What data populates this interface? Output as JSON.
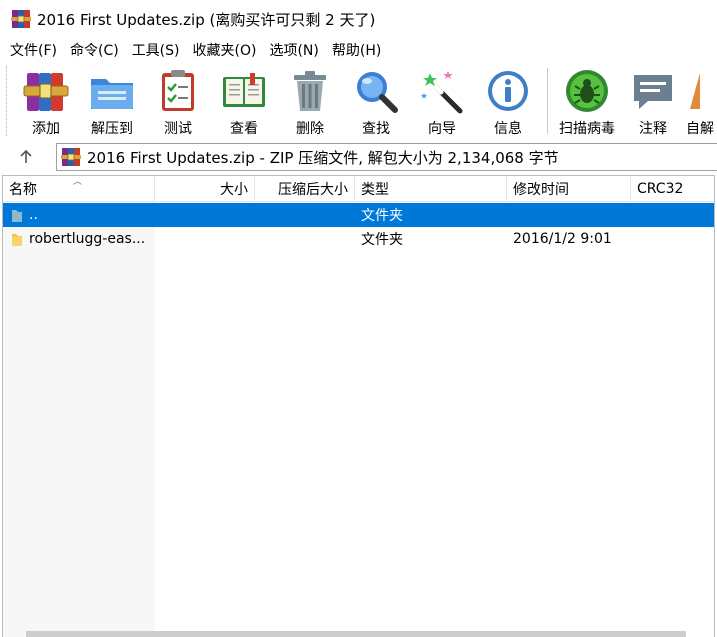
{
  "window": {
    "title": "2016 First Updates.zip (离购买许可只剩 2 天了)"
  },
  "menu": {
    "items": [
      "文件(F)",
      "命令(C)",
      "工具(S)",
      "收藏夹(O)",
      "选项(N)",
      "帮助(H)"
    ]
  },
  "toolbar": {
    "add": "添加",
    "extract": "解压到",
    "test": "测试",
    "view": "查看",
    "delete": "删除",
    "find": "查找",
    "wizard": "向导",
    "info": "信息",
    "virus_scan": "扫描病毒",
    "comment": "注释",
    "self_extract": "自解"
  },
  "address": {
    "text": "2016 First Updates.zip - ZIP 压缩文件, 解包大小为 2,134,068 字节"
  },
  "columns": {
    "name": "名称",
    "size": "大小",
    "packed": "压缩后大小",
    "type": "类型",
    "modified": "修改时间",
    "crc": "CRC32"
  },
  "rows": [
    {
      "name": "..",
      "size": "",
      "packed": "",
      "type": "文件夹",
      "modified": "",
      "crc": "",
      "selected": true
    },
    {
      "name": "robertlugg-eas...",
      "size": "",
      "packed": "",
      "type": "文件夹",
      "modified": "2016/1/2 9:01",
      "crc": "",
      "selected": false
    }
  ],
  "colors": {
    "selection": "#0078d7",
    "folder": "#f4c542"
  }
}
